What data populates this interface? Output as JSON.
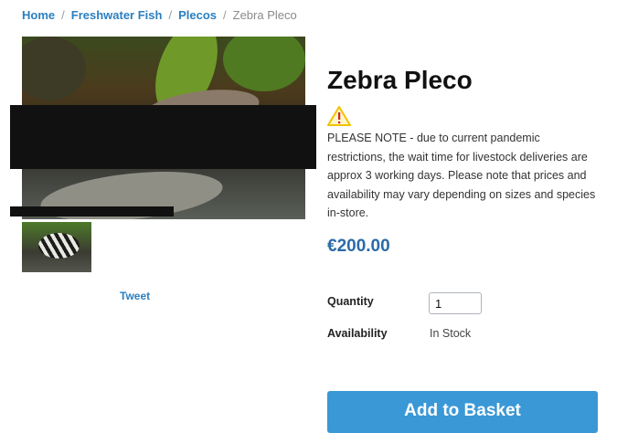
{
  "breadcrumb": {
    "items": [
      "Home",
      "Freshwater Fish",
      "Plecos"
    ],
    "separator": "/",
    "current": "Zebra Pleco"
  },
  "product": {
    "title": "Zebra Pleco",
    "notice_icon": "warning-icon",
    "notice": "PLEASE NOTE - due to current pandemic restrictions, the wait time for livestock deliveries are approx 3 working days. Please note that prices and availability may vary depending on sizes and species in-store.",
    "price": "€200.00",
    "quantity_label": "Quantity",
    "quantity_value": "1",
    "availability_label": "Availability",
    "availability_value": "In Stock",
    "add_button_label": "Add to Basket"
  },
  "social": {
    "tweet_label": "Tweet"
  },
  "colors": {
    "link": "#2a7fc1",
    "price": "#2a6aa8",
    "button": "#3a98d6",
    "warning": "#f2c200"
  }
}
